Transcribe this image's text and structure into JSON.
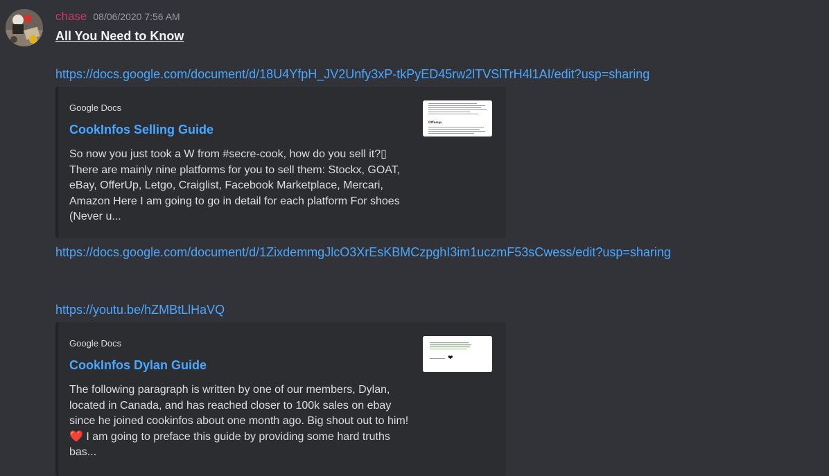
{
  "message": {
    "username": "chase",
    "timestamp": "08/06/2020 7:56 AM",
    "title": "All You Need to Know",
    "username_color": "#c23c63",
    "link_color": "#4aa7ff"
  },
  "links": [
    "https://docs.google.com/document/d/18U4YfpH_JV2Unfy3xP-tkPyED45rw2lTVSlTrH4l1AI/edit?usp=sharing",
    "https://docs.google.com/document/d/1ZixdemmgJlcO3XrEsKBMCzpghI3im1uczmF53sCwess/edit?usp=sharing",
    "https://youtu.be/hZMBtLlHaVQ"
  ],
  "embeds": [
    {
      "provider": "Google Docs",
      "title": "CookInfos Selling Guide",
      "description": "So now you just took a W from #secre-cook, how do you sell it?▯ There are mainly nine platforms for you to sell them: Stockx, GOAT, eBay, OfferUp, Letgo, Craiglist, Facebook Marketplace, Mercari, Amazon Here I am going to go in detail for each platform For shoes (Never u...",
      "thumbnail_heading": "Offerup"
    },
    {
      "provider": "Google Docs",
      "title": "CookInfos Dylan Guide",
      "description_before_emoji": "The following paragraph is written by one of our members, Dylan, located in Canada, and has reached closer to 100k sales on ebay since he joined cookinfos about one month ago. Big shout out to him! ",
      "emoji": "❤️",
      "description_after_emoji": " I am going to preface this guide by providing some hard truths bas...",
      "thumbnail_emoji": "❤"
    }
  ]
}
